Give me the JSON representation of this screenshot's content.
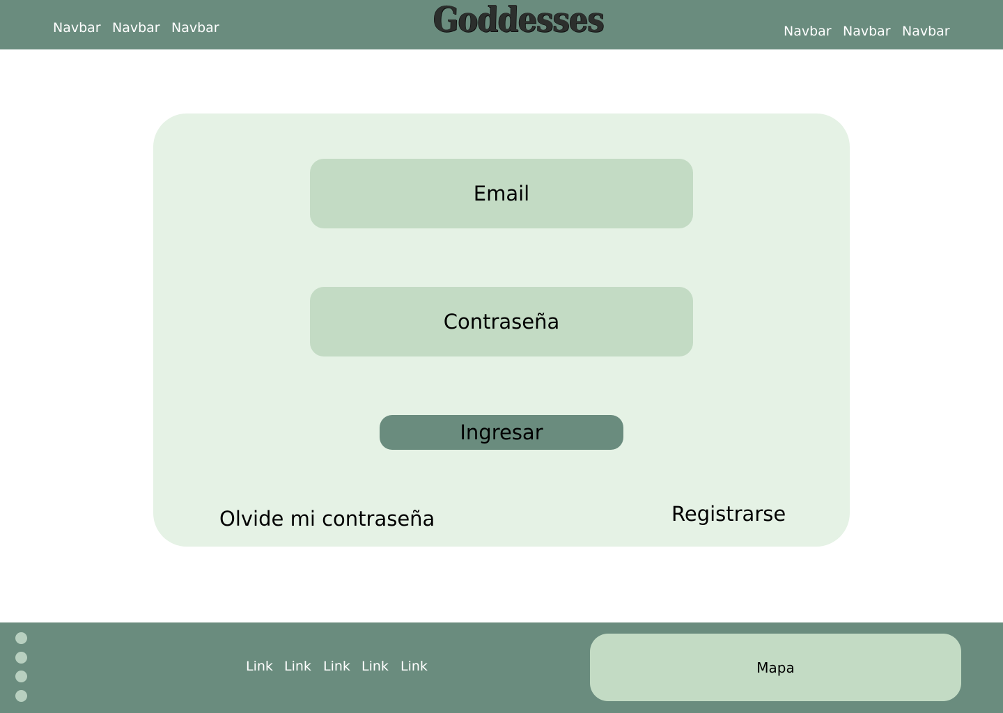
{
  "header": {
    "logo_text": "Goddesses",
    "nav_left": [
      "Navbar",
      "Navbar",
      "Navbar"
    ],
    "nav_right": [
      "Navbar",
      "Navbar",
      "Navbar"
    ]
  },
  "login": {
    "email_placeholder": "Email",
    "password_placeholder": "Contraseña",
    "submit_label": "Ingresar",
    "forgot_label": "Olvide mi contraseña",
    "register_label": "Registrarse"
  },
  "footer": {
    "links": [
      "Link",
      "Link",
      "Link",
      "Link",
      "Link"
    ],
    "map_label": "Mapa",
    "social_icons": [
      "dot-icon",
      "dot-icon",
      "dot-icon",
      "dot-icon"
    ]
  },
  "colors": {
    "bar": "#6a8c7e",
    "card": "#e5f2e5",
    "field": "#c3dbc4",
    "dot": "#b8d0c0"
  }
}
